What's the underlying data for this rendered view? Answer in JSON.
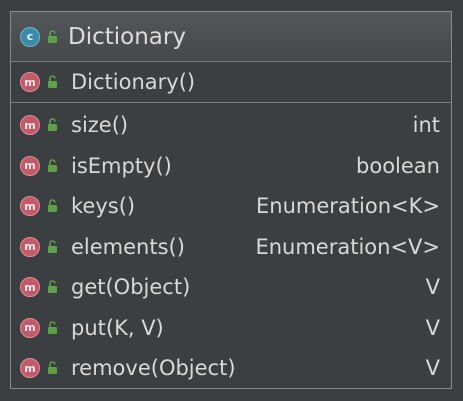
{
  "class": {
    "badge": "c",
    "name": "Dictionary",
    "badge_color": "#3d8aa8",
    "access_icon": "unlocked-public-icon"
  },
  "constructors": [
    {
      "badge": "m",
      "signature": "Dictionary()",
      "return_type": ""
    }
  ],
  "methods": [
    {
      "badge": "m",
      "signature": "size()",
      "return_type": "int"
    },
    {
      "badge": "m",
      "signature": "isEmpty()",
      "return_type": "boolean"
    },
    {
      "badge": "m",
      "signature": "keys()",
      "return_type": "Enumeration<K>"
    },
    {
      "badge": "m",
      "signature": "elements()",
      "return_type": "Enumeration<V>"
    },
    {
      "badge": "m",
      "signature": "get(Object)",
      "return_type": "V"
    },
    {
      "badge": "m",
      "signature": "put(K, V)",
      "return_type": "V"
    },
    {
      "badge": "m",
      "signature": "remove(Object)",
      "return_type": "V"
    }
  ],
  "colors": {
    "background": "#3c3f41",
    "method_badge": "#c15b6a",
    "access_icon": "#5ea14a",
    "text": "#d8d8d8"
  }
}
